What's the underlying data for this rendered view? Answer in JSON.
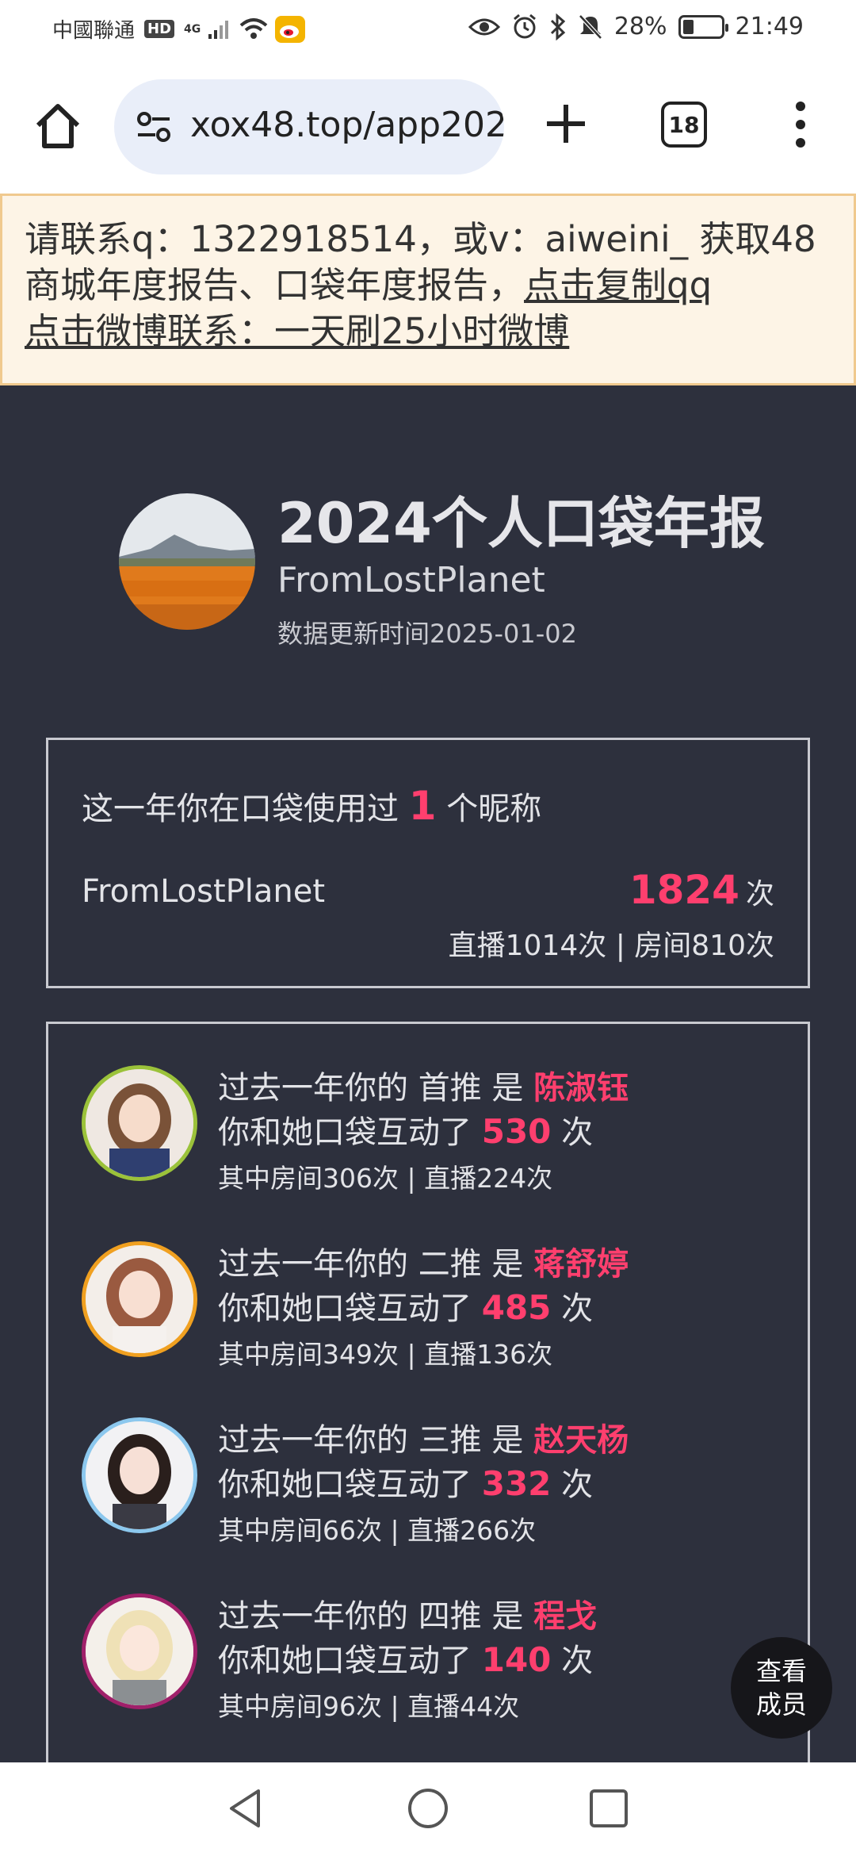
{
  "status_bar": {
    "carrier": "中國聯通",
    "hd_badge": "HD",
    "network": "4G",
    "battery_percent": "28%",
    "battery_level": 0.28,
    "time": "21:49"
  },
  "browser": {
    "url": "xox48.top/app202",
    "tab_count": "18"
  },
  "notice": {
    "text_main": "请联系q：1322918514，或v：aiweini_ 获取48商城年度报告、口袋年度报告，",
    "link_copy_qq": "点击复制qq",
    "link_weibo": "点击微博联系：一天刷25小时微博"
  },
  "report": {
    "title": "2024个人口袋年报",
    "username": "FromLostPlanet",
    "updated": "数据更新时间2025-01-02",
    "nickname_card": {
      "prefix": "这一年你在口袋使用过",
      "count": "1",
      "suffix": "个昵称",
      "nickname": "FromLostPlanet",
      "total": "1824",
      "total_unit": "次",
      "breakdown": "直播1014次 | 房间810次"
    },
    "oshi": [
      {
        "intro": "过去一年你的 首推 是",
        "name": "陈淑钰",
        "interact_prefix": "你和她口袋互动了",
        "count": "530",
        "unit": "次",
        "detail": "其中房间306次 | 直播224次",
        "ring_color": "#9bc23a"
      },
      {
        "intro": "过去一年你的 二推 是",
        "name": "蒋舒婷",
        "interact_prefix": "你和她口袋互动了",
        "count": "485",
        "unit": "次",
        "detail": "其中房间349次 | 直播136次",
        "ring_color": "#f0a020"
      },
      {
        "intro": "过去一年你的 三推 是",
        "name": "赵天杨",
        "interact_prefix": "你和她口袋互动了",
        "count": "332",
        "unit": "次",
        "detail": "其中房间66次 | 直播266次",
        "ring_color": "#8cc8ee"
      },
      {
        "intro": "过去一年你的 四推 是",
        "name": "程戈",
        "interact_prefix": "你和她口袋互动了",
        "count": "140",
        "unit": "次",
        "detail": "其中房间96次 | 直播44次",
        "ring_color": "#a0206a"
      }
    ]
  },
  "fab": {
    "line1": "查看",
    "line2": "成员"
  },
  "colors": {
    "report_bg": "#2d303d",
    "accent_pink": "#ff3f6e",
    "notice_bg": "#fdf4e6"
  }
}
